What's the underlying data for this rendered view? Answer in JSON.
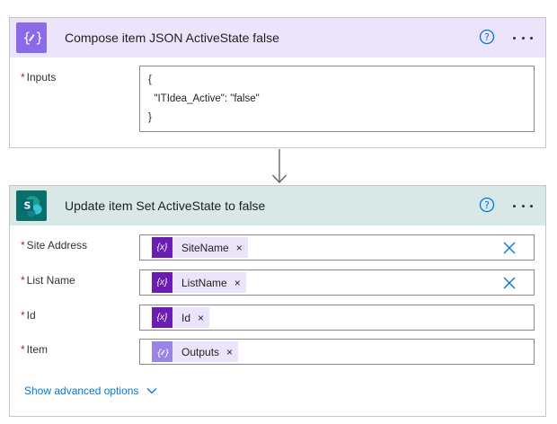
{
  "compose": {
    "title": "Compose item JSON ActiveState false",
    "inputs_label": "Inputs",
    "json_lines": [
      "{",
      "  \"ITIdea_Active\": \"false\"",
      "}"
    ]
  },
  "update": {
    "title": "Update item Set ActiveState to false",
    "fields": [
      {
        "label": "Site Address",
        "token": "SiteName"
      },
      {
        "label": "List Name",
        "token": "ListName"
      },
      {
        "label": "Id",
        "token": "Id"
      },
      {
        "label": "Item",
        "token": "Outputs"
      }
    ],
    "advanced_label": "Show advanced options"
  },
  "common": {
    "required_marker": "*",
    "token_remove": "×",
    "variable_glyph": "{x}"
  },
  "colors": {
    "compose_header": "#ebe4fb",
    "sharepoint_header": "#d7e8e6",
    "accent_blue": "#0078d4",
    "required_red": "#a4262c",
    "variable_token": "#6a1cb3"
  }
}
